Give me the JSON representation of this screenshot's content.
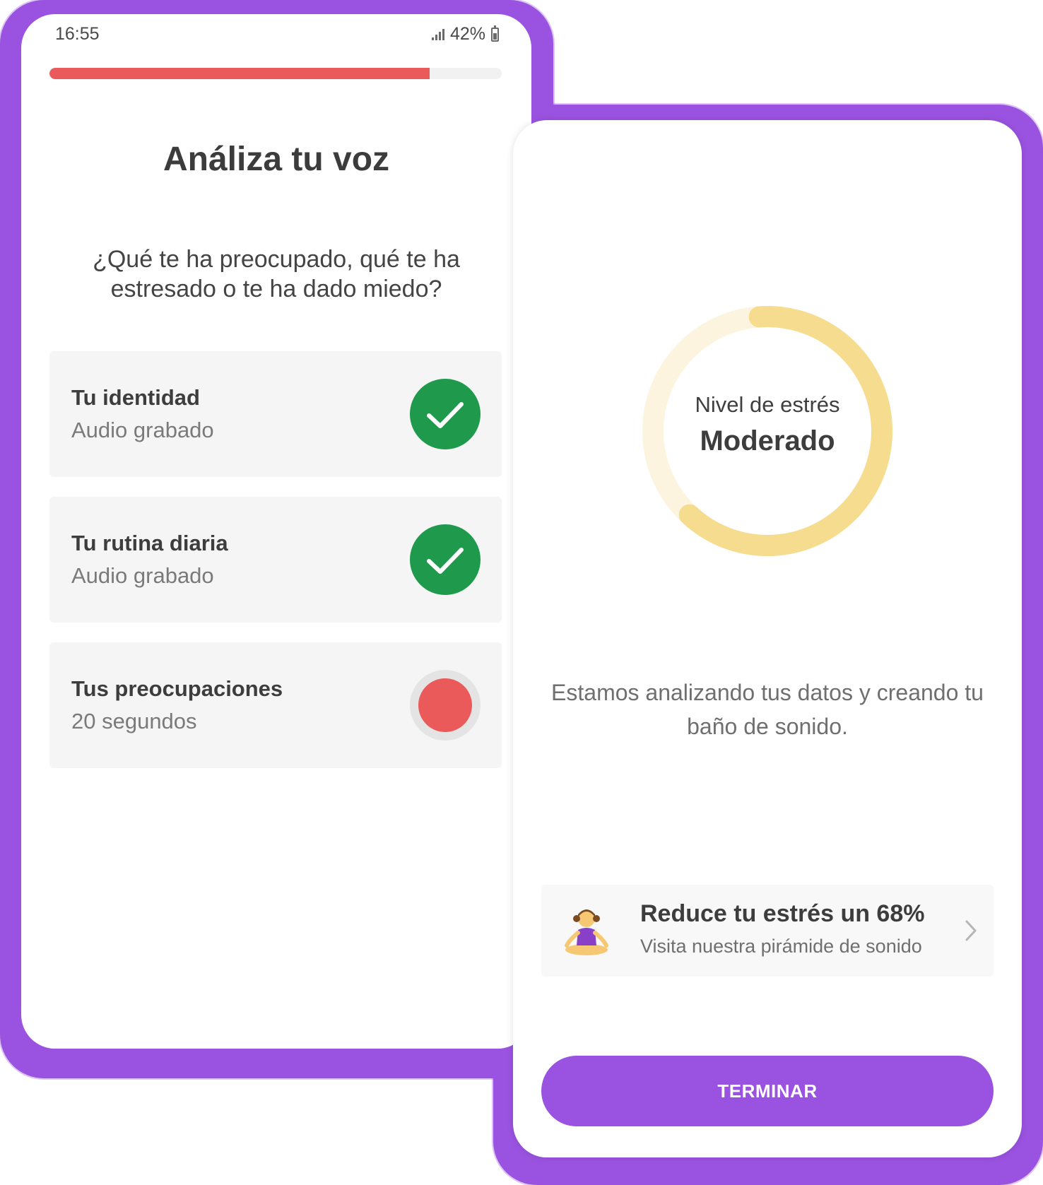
{
  "left_screen": {
    "status_bar": {
      "time": "16:55",
      "battery": "42%"
    },
    "progress": {
      "fraction": 0.84,
      "color": "#ea5a5a"
    },
    "title": "Análiza tu voz",
    "question": "¿Qué te ha preocupado, qué te ha estresado o te ha dado miedo?",
    "items": [
      {
        "title": "Tu identidad",
        "subtitle": "Audio grabado",
        "state": "done",
        "icon": "check-icon"
      },
      {
        "title": "Tu rutina diaria",
        "subtitle": "Audio grabado",
        "state": "done",
        "icon": "check-icon"
      },
      {
        "title": "Tus preocupaciones",
        "subtitle": "20 segundos",
        "state": "recording",
        "icon": "record-icon"
      }
    ]
  },
  "right_screen": {
    "stress": {
      "label": "Nivel de estrés",
      "value": "Moderado",
      "level_fraction": 0.63,
      "color": "#f5dc8f"
    },
    "analyzing_text": "Estamos analizando tus datos y creando tu baño de sonido.",
    "promo": {
      "title": "Reduce tu estrés un 68%",
      "subtitle": "Visita nuestra pirámide de sonido",
      "icon": "meditation-icon"
    },
    "button": "TERMINAR"
  },
  "colors": {
    "accent": "#9a53e0",
    "success": "#1f9a4d",
    "record": "#ea5a5a"
  }
}
